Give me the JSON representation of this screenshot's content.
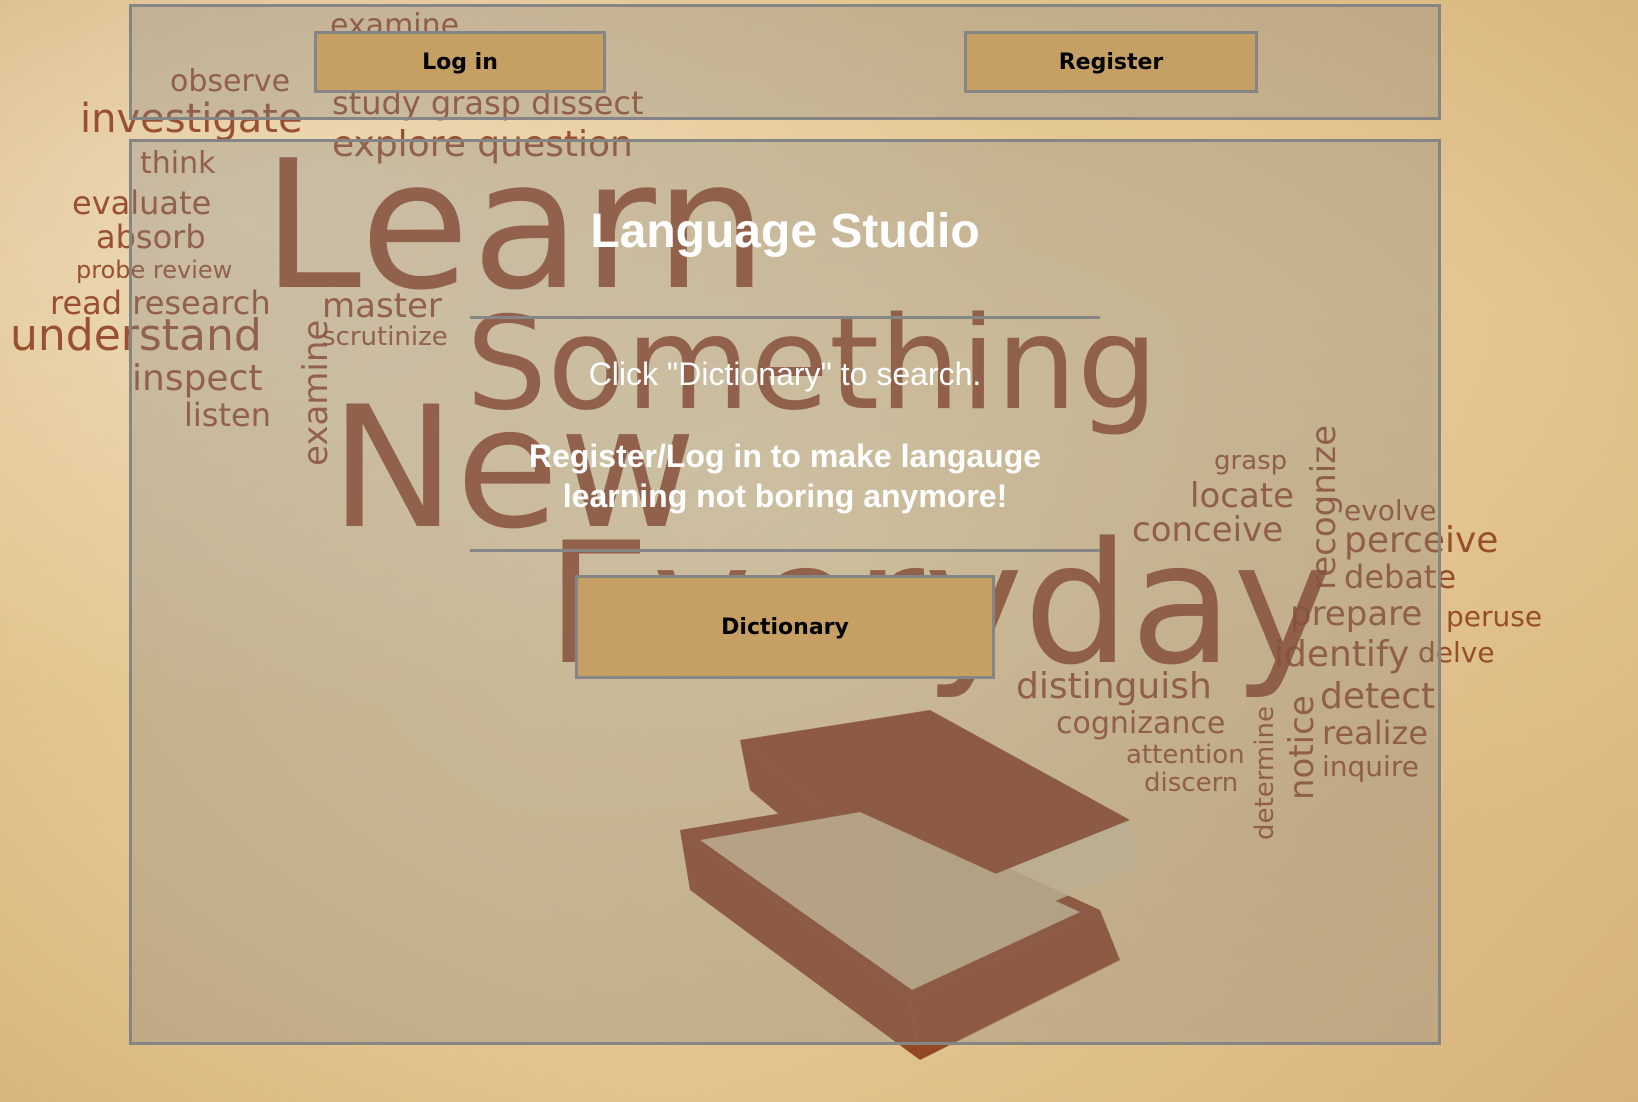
{
  "background": {
    "words": [
      "Learn",
      "Something",
      "New",
      "Everyday",
      "investigate",
      "observe",
      "examine",
      "study grasp dissect",
      "explore question",
      "think",
      "evaluate",
      "absorb",
      "probe review",
      "read research",
      "understand",
      "inspect",
      "listen",
      "master",
      "scrutinize",
      "examine",
      "grasp",
      "locate",
      "conceive",
      "recognize",
      "evolve",
      "perceive",
      "debate",
      "prepare",
      "peruse",
      "identify",
      "delve",
      "distinguish",
      "detect",
      "cognizance",
      "realize",
      "attention",
      "inquire",
      "discern",
      "notice",
      "determine"
    ]
  },
  "nav": {
    "login_label": "Log in",
    "register_label": "Register"
  },
  "main": {
    "title": "Language Studio",
    "hint": "Click \"Dictionary\" to search.",
    "promo": "Register/Log in to make langauge learning not boring anymore!",
    "dictionary_label": "Dictionary"
  },
  "colors": {
    "button_bg": "#c69f65",
    "border": "#858585",
    "text_light": "#ffffff",
    "word_cloud": "#8a3a1c"
  }
}
